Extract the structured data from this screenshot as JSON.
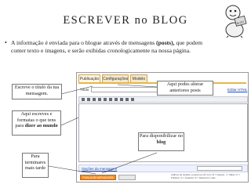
{
  "slide": {
    "title": "ESCREVER no BLOG",
    "bullet_part1": "A informação é enviada para o blogue através de mensagens ",
    "bullet_bold": "(posts),",
    "bullet_part2": " que podem conter texto e imagens, e serão exibidas cronologicamente na nossa página."
  },
  "editor_screen": {
    "tabs": [
      "Publicação",
      "Configurações",
      "Modelo"
    ],
    "title_label": "Título",
    "edit_html_link": "Editar HTML",
    "options_link": "Opções da mensagem",
    "publish_button": "PUBLICAR MENSAGEM",
    "bottom_note": "Atalhos de teclado: pressione Ctrl com: B = Negrito, I = Itálico, P = Publicar, S = Guardar, D = Rascunho mais..."
  },
  "callouts": {
    "title_tip": "Escreve o título da tua mensagem.",
    "posts_tip": "Aqui podes alterar anteriores posts",
    "write_tip_normal": "Aqui escreves e formatas o que tens para ",
    "write_tip_bold": "dizer ao mundo",
    "publish_tip_normal": "Para disponibilizar no ",
    "publish_tip_bold": "blog",
    "finish_tip": "Para terminares mais tarde"
  },
  "colors": {
    "tab_bar": "#e4b64c",
    "publish_button": "#f08a24"
  }
}
